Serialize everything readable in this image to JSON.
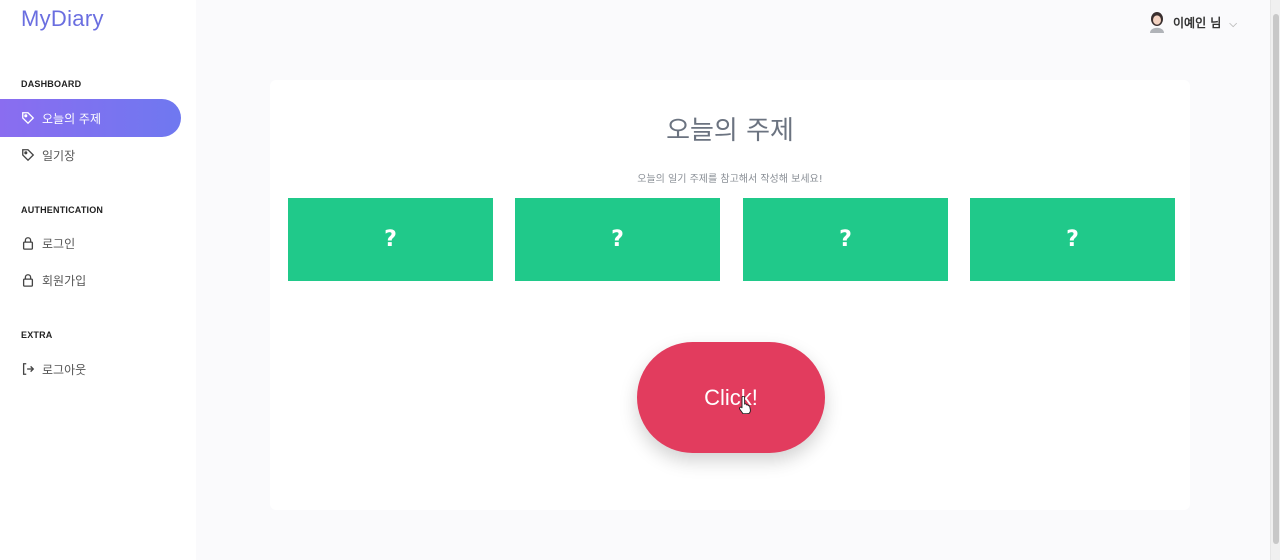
{
  "brand": "MyDiary",
  "sidebar": {
    "sections": [
      {
        "title": "DASHBOARD"
      },
      {
        "title": "AUTHENTICATION"
      },
      {
        "title": "EXTRA"
      }
    ],
    "items": [
      {
        "label": "오늘의 주제",
        "icon": "tag-icon",
        "active": true
      },
      {
        "label": "일기장",
        "icon": "tag-icon",
        "active": false
      },
      {
        "label": "로그인",
        "icon": "lock-icon",
        "active": false
      },
      {
        "label": "회원가입",
        "icon": "lock-icon",
        "active": false
      },
      {
        "label": "로그아웃",
        "icon": "logout-icon",
        "active": false
      }
    ]
  },
  "header": {
    "user_name": "이예인 님",
    "user_icon": "avatar-icon"
  },
  "main": {
    "title": "오늘의 주제",
    "subtitle": "오늘의 일기 주제를 참고해서 작성해 보세요!",
    "topics": [
      {
        "label": "?"
      },
      {
        "label": "?"
      },
      {
        "label": "?"
      },
      {
        "label": "?"
      }
    ],
    "button_label": "Click!"
  },
  "colors": {
    "brand": "#6a6ee0",
    "active_gradient_start": "#8a6df0",
    "active_gradient_end": "#6f78f0",
    "topic_box": "#20c98a",
    "click_button": "#e23c5e"
  }
}
